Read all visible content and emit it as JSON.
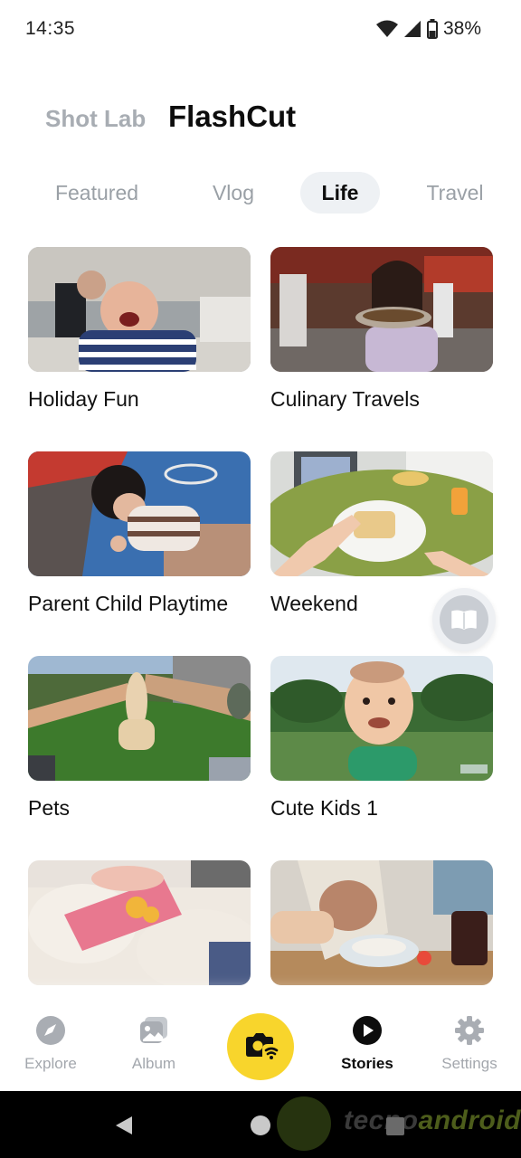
{
  "status_bar": {
    "time": "14:35",
    "battery": "38%"
  },
  "header": {
    "tabs": [
      {
        "label": "Shot Lab",
        "active": false
      },
      {
        "label": "FlashCut",
        "active": true
      }
    ]
  },
  "categories": [
    {
      "label": "Featured",
      "active": false
    },
    {
      "label": "Vlog",
      "active": false
    },
    {
      "label": "Life",
      "active": true
    },
    {
      "label": "Travel",
      "active": false
    }
  ],
  "cards": [
    {
      "title": "Holiday Fun"
    },
    {
      "title": "Culinary Travels"
    },
    {
      "title": "Parent Child Playtime"
    },
    {
      "title": "Weekend"
    },
    {
      "title": "Pets"
    },
    {
      "title": "Cute Kids 1"
    },
    {
      "title": ""
    },
    {
      "title": ""
    }
  ],
  "bottom_nav": {
    "items": [
      {
        "label": "Explore",
        "icon": "compass-icon",
        "active": false
      },
      {
        "label": "Album",
        "icon": "album-icon",
        "active": false
      },
      {
        "label": "",
        "icon": "camera-wifi-icon",
        "active": false
      },
      {
        "label": "Stories",
        "icon": "play-circle-icon",
        "active": true
      },
      {
        "label": "Settings",
        "icon": "gear-icon",
        "active": false
      }
    ]
  },
  "watermark": {
    "part1": "tecno",
    "part2": "android"
  },
  "colors": {
    "accent": "#f8d52c",
    "active_text": "#0d0d0d",
    "inactive_text": "#a3a7ad",
    "tab_pill": "#eef1f4"
  }
}
